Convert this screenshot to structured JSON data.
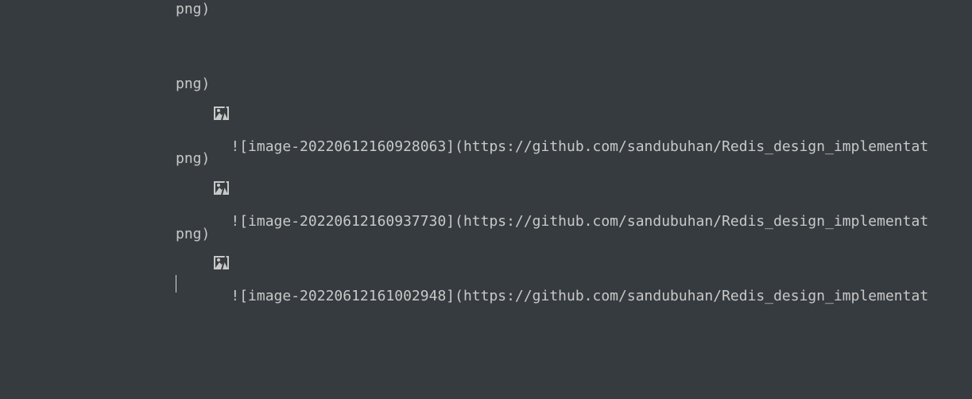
{
  "editor": {
    "lines": [
      {
        "kind": "text",
        "text": "png)"
      },
      {
        "kind": "image",
        "text": "![image-20220612160928063](https://github.com/sandubuhan/Redis_design_implementat",
        "icon": "broken-image-icon"
      },
      {
        "kind": "text",
        "text": "png)"
      },
      {
        "kind": "image",
        "text": "![image-20220612160937730](https://github.com/sandubuhan/Redis_design_implementat",
        "icon": "broken-image-icon"
      },
      {
        "kind": "text",
        "text": "png)"
      },
      {
        "kind": "image",
        "text": "![image-20220612161002948](https://github.com/sandubuhan/Redis_design_implementat",
        "icon": "broken-image-icon"
      },
      {
        "kind": "text",
        "text": "png)"
      }
    ]
  },
  "colors": {
    "background": "#363b40",
    "text": "#c8c9c7",
    "icon": "#c8c9c7"
  }
}
